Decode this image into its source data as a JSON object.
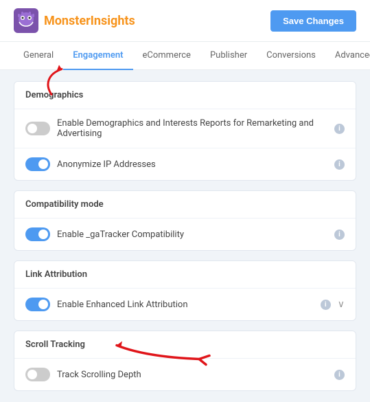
{
  "header": {
    "logo_text_regular": "Monster",
    "logo_text_accent": "Insights",
    "save_button_label": "Save Changes"
  },
  "nav": {
    "tabs": [
      {
        "label": "General",
        "active": false
      },
      {
        "label": "Engagement",
        "active": true
      },
      {
        "label": "eCommerce",
        "active": false
      },
      {
        "label": "Publisher",
        "active": false
      },
      {
        "label": "Conversions",
        "active": false
      },
      {
        "label": "Advanced",
        "active": false
      }
    ]
  },
  "sections": {
    "demographics": {
      "title": "Demographics",
      "rows": [
        {
          "label": "Enable Demographics and Interests Reports for Remarketing and Advertising",
          "enabled": false
        },
        {
          "label": "Anonymize IP Addresses",
          "enabled": true
        }
      ]
    },
    "compatibility": {
      "title": "Compatibility mode",
      "rows": [
        {
          "label": "Enable _gaTracker Compatibility",
          "enabled": true
        }
      ]
    },
    "link_attribution": {
      "title": "Link Attribution",
      "rows": [
        {
          "label": "Enable Enhanced Link Attribution",
          "enabled": true,
          "expandable": true
        }
      ]
    },
    "scroll_tracking": {
      "title": "Scroll Tracking",
      "rows": [
        {
          "label": "Track Scrolling Depth",
          "enabled": false
        }
      ]
    }
  },
  "icons": {
    "info": "i",
    "chevron_down": "∨",
    "logo_emoji": "👾"
  }
}
